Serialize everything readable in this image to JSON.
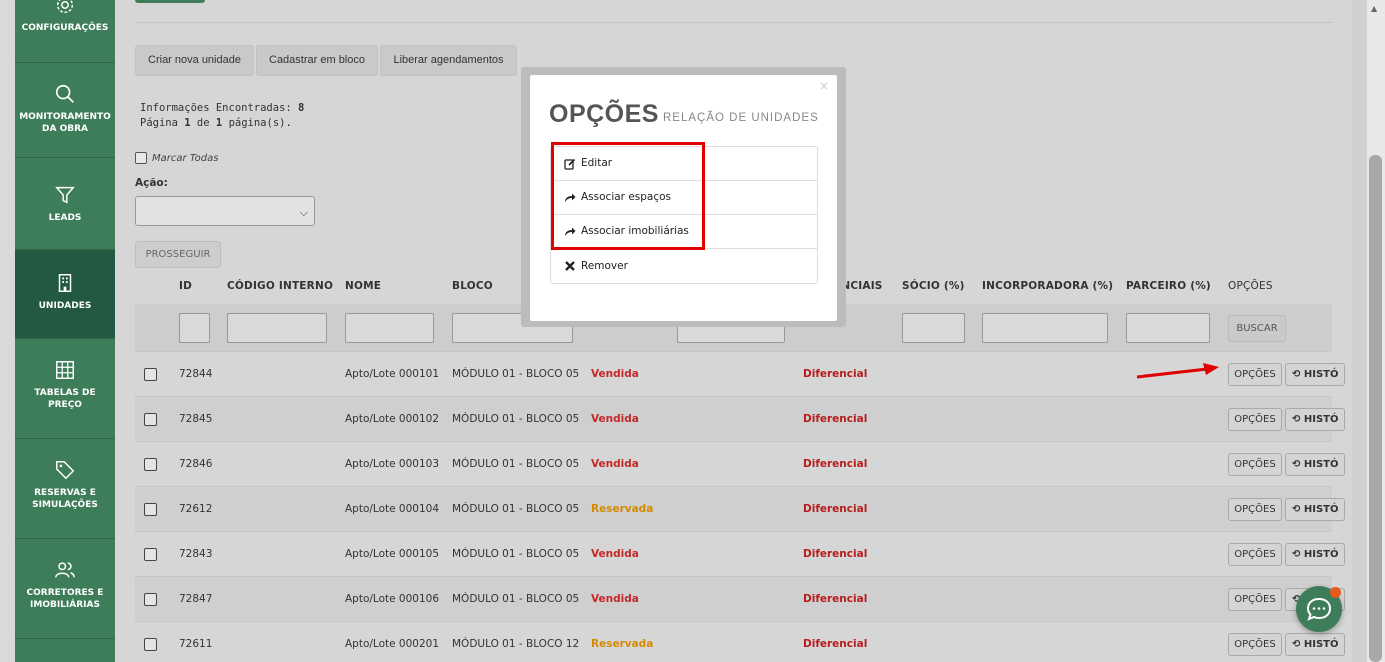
{
  "sidebar": {
    "items": [
      {
        "label": "CONFIGURAÇÕES",
        "icon": "gear-icon"
      },
      {
        "label": "MONITORAMENTO DA OBRA",
        "icon": "search-icon"
      },
      {
        "label": "LEADS",
        "icon": "funnel-icon"
      },
      {
        "label": "UNIDADES",
        "icon": "building-icon",
        "active": true
      },
      {
        "label": "TABELAS DE PREÇO",
        "icon": "grid-icon"
      },
      {
        "label": "RESERVAS E SIMULAÇÕES",
        "icon": "tag-icon"
      },
      {
        "label": "CORRETORES E IMOBILIÁRIAS",
        "icon": "users-icon"
      }
    ]
  },
  "toolbar": {
    "create_label": "Criar nova unidade",
    "bulk_label": "Cadastrar em bloco",
    "release_label": "Liberar agendamentos"
  },
  "info": {
    "found_label": "Informações Encontradas:",
    "found_count": "8",
    "page_prefix": "Página",
    "page_current": "1",
    "page_of": "de",
    "page_total": "1",
    "page_suffix": "página(s)."
  },
  "bulk": {
    "select_all_label": "Marcar Todas",
    "action_label": "Ação:",
    "proceed_label": "PROSSEGUIR"
  },
  "table": {
    "headers": {
      "id": "ID",
      "internal_code": "CÓDIGO INTERNO",
      "name": "NOME",
      "block": "BLOCO",
      "differentials": "ENCIAIS",
      "partner_pct": "SÓCIO (%)",
      "developer_pct": "INCORPORADORA (%)",
      "broker_pct": "PARCEIRO (%)",
      "options": "OPÇÕES"
    },
    "search_label": "BUSCAR",
    "options_btn": "OPÇÕES",
    "history_btn": "HISTÓ",
    "rows": [
      {
        "id": "72844",
        "name": "Apto/Lote 000101",
        "block": "MÓDULO 01 - BLOCO 05",
        "status": "Vendida",
        "diff": "Diferencial"
      },
      {
        "id": "72845",
        "name": "Apto/Lote 000102",
        "block": "MÓDULO 01 - BLOCO 05",
        "status": "Vendida",
        "diff": "Diferencial"
      },
      {
        "id": "72846",
        "name": "Apto/Lote 000103",
        "block": "MÓDULO 01 - BLOCO 05",
        "status": "Vendida",
        "diff": "Diferencial"
      },
      {
        "id": "72612",
        "name": "Apto/Lote 000104",
        "block": "MÓDULO 01 - BLOCO 05",
        "status": "Reservada",
        "diff": "Diferencial"
      },
      {
        "id": "72843",
        "name": "Apto/Lote 000105",
        "block": "MÓDULO 01 - BLOCO 05",
        "status": "Vendida",
        "diff": "Diferencial"
      },
      {
        "id": "72847",
        "name": "Apto/Lote 000106",
        "block": "MÓDULO 01 - BLOCO 05",
        "status": "Vendida",
        "diff": "Diferencial"
      },
      {
        "id": "72611",
        "name": "Apto/Lote 000201",
        "block": "MÓDULO 01 - BLOCO 12",
        "status": "Reservada",
        "diff": "Diferencial"
      }
    ]
  },
  "colors": {
    "sold": "#c62828",
    "reserved": "#d68a00",
    "brand": "#3e7d5a",
    "highlight": "#e00000"
  },
  "modal": {
    "title": "OPÇÕES",
    "subtitle": "RELAÇÃO DE UNIDADES",
    "close": "×",
    "items": [
      {
        "label": "Editar",
        "icon": "edit-icon"
      },
      {
        "label": "Associar espaços",
        "icon": "share-arrow-icon"
      },
      {
        "label": "Associar imobiliárias",
        "icon": "share-arrow-icon"
      },
      {
        "label": "Remover",
        "icon": "x-icon"
      }
    ]
  }
}
